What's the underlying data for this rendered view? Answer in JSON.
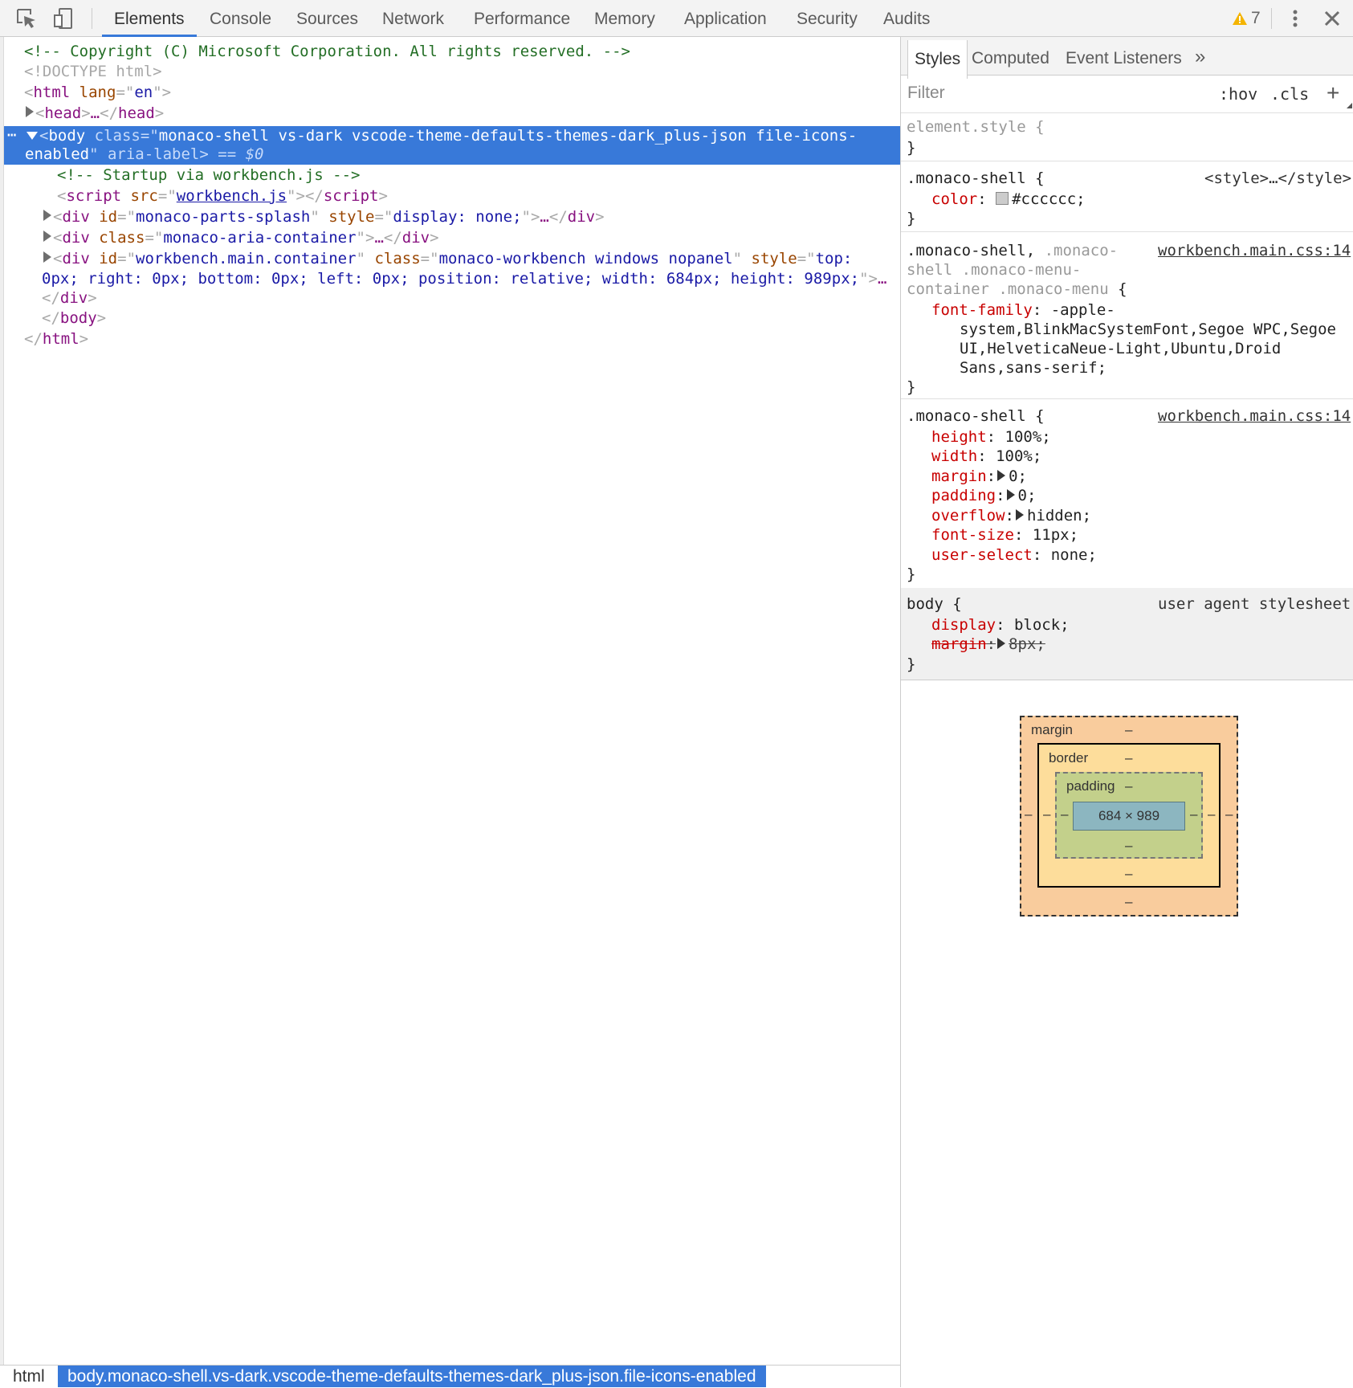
{
  "toolbar": {
    "icons": [
      "inspect-element-icon",
      "device-toolbar-icon"
    ],
    "tabs": [
      {
        "label": "Elements",
        "active": true
      },
      {
        "label": "Console"
      },
      {
        "label": "Sources"
      },
      {
        "label": "Network"
      },
      {
        "label": "Performance"
      },
      {
        "label": "Memory"
      },
      {
        "label": "Application"
      },
      {
        "label": "Security"
      },
      {
        "label": "Audits"
      }
    ],
    "warning_count": "7",
    "accent_color": "#3879d9",
    "warning_color": "#f4b400"
  },
  "dom": {
    "comment_copyright": "<!-- Copyright (C) Microsoft Corporation. All rights reserved. -->",
    "doctype": "<!DOCTYPE html>",
    "html_tag": "html",
    "html_lang_attr": "lang",
    "html_lang_val": "en",
    "head_tag": "head",
    "ellipsis": "…",
    "body_tag": "body",
    "body_class_attr": "class",
    "body_class_val_1": "monaco-shell vs-dark vscode-theme-defaults-themes-dark_plus-json file-icons-",
    "body_class_val_2": "enabled",
    "body_aria_attr": "aria-label",
    "body_dollar": "== $0",
    "comment_startup": "<!-- Startup via workbench.js -->",
    "script_tag": "script",
    "script_src_attr": "src",
    "script_src_val": "workbench.js",
    "div_tag": "div",
    "splash_id_attr": "id",
    "splash_id_val": "monaco-parts-splash",
    "splash_style_attr": "style",
    "splash_style_val": "display: none;",
    "aria_class_attr": "class",
    "aria_class_val": "monaco-aria-container",
    "wb_id_attr": "id",
    "wb_id_val": "workbench.main.container",
    "wb_class_attr": "class",
    "wb_class_val": "monaco-workbench windows nopanel",
    "wb_style_attr": "style",
    "wb_style_val_1": "top:",
    "wb_style_val_2": "0px; right: 0px; bottom: 0px; left: 0px; position: relative; width: 684px; height: 989px;",
    "wb_trunc": "…"
  },
  "breadcrumb": {
    "html": "html",
    "body": "body.monaco-shell.vs-dark.vscode-theme-defaults-themes-dark_plus-json.file-icons-enabled"
  },
  "sidebar": {
    "tabs": [
      {
        "label": "Styles",
        "active": true
      },
      {
        "label": "Computed"
      },
      {
        "label": "Event Listeners"
      }
    ],
    "more": "»",
    "filter_placeholder": "Filter",
    "hov": ":hov",
    "cls": ".cls",
    "add": "+",
    "rules": {
      "element_style": "element.style {",
      "close": "}",
      "r1_selector": ".monaco-shell {",
      "r1_source": "<style>…</style>",
      "r1_prop": "color",
      "r1_val": "#cccccc;",
      "r1_swatch": "#cccccc",
      "r2_sel_a": ".monaco-shell,",
      "r2_sel_b": ".monaco-",
      "r2_sel_c": "shell .monaco-menu-",
      "r2_sel_d": "container .monaco-menu",
      "r2_brace": "{",
      "r2_source": "workbench.main.css:14",
      "r2_prop": "font-family",
      "r2_val_1": "-apple-",
      "r2_val_2": "system,BlinkMacSystemFont,Segoe WPC,Segoe",
      "r2_val_3": "UI,HelveticaNeue-Light,Ubuntu,Droid",
      "r2_val_4": "Sans,sans-serif;",
      "r3_selector": ".monaco-shell {",
      "r3_source": "workbench.main.css:14",
      "r3_props": [
        {
          "name": "height",
          "val": "100%;"
        },
        {
          "name": "width",
          "val": "100%;"
        },
        {
          "name": "margin",
          "val": "0;"
        },
        {
          "name": "padding",
          "val": "0;"
        },
        {
          "name": "overflow",
          "val": "hidden;"
        },
        {
          "name": "font-size",
          "val": "11px;"
        },
        {
          "name": "user-select",
          "val": "none;"
        }
      ],
      "r4_selector": "body {",
      "r4_source": "user agent stylesheet",
      "r4_prop1": "display",
      "r4_val1": "block;",
      "r4_prop2": "margin",
      "r4_val2": "8px;"
    },
    "box_model": {
      "margin": "margin",
      "border": "border",
      "padding": "padding",
      "dash": "–",
      "content": "684 × 989"
    }
  }
}
